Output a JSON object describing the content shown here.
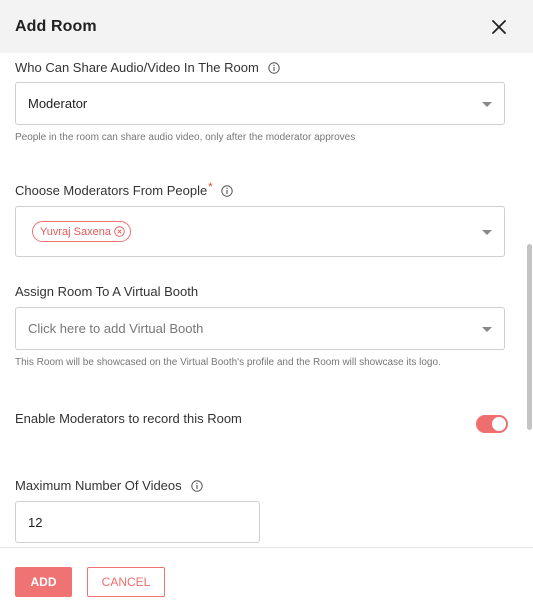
{
  "dialog": {
    "title": "Add Room",
    "close_icon": "close-icon"
  },
  "share_av": {
    "label": "Who Can Share Audio/Video In The Room",
    "value": "Moderator",
    "helper": "People in the room can share audio video, only after the moderator approves"
  },
  "moderators": {
    "label": "Choose Moderators From People",
    "required_mark": "*",
    "chips": [
      "Yuvraj Saxena"
    ]
  },
  "virtual_booth": {
    "label": "Assign Room To A Virtual Booth",
    "placeholder": "Click here to add Virtual Booth",
    "helper": "This Room will be showcased on the Virtual Booth's profile and the Room will showcase its logo."
  },
  "record": {
    "label": "Enable Moderators to record this Room",
    "enabled": true
  },
  "max_videos": {
    "label": "Maximum Number Of Videos",
    "value": "12"
  },
  "footer": {
    "add_label": "ADD",
    "cancel_label": "CANCEL"
  },
  "colors": {
    "accent": "#ef7373",
    "header_bg": "#f3f3f3"
  }
}
